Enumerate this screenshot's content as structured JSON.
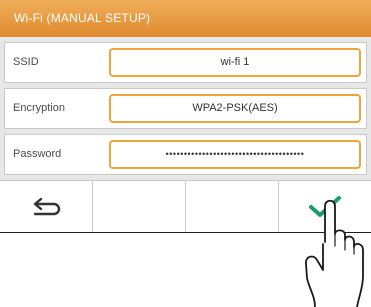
{
  "title": "Wi-Fi (MANUAL SETUP)",
  "rows": [
    {
      "label": "SSID",
      "value": "wi-fi 1"
    },
    {
      "label": "Encryption",
      "value": "WPA2-PSK(AES)"
    },
    {
      "label": "Password",
      "value": "••••••••••••••••••••••••••••••••••••••"
    }
  ],
  "buttons": [
    {
      "icon": "back-arrow-icon"
    },
    {
      "icon": ""
    },
    {
      "icon": ""
    },
    {
      "icon": "checkmark-icon"
    }
  ],
  "colors": {
    "title_bar": "#e8963a",
    "field_border": "#f0a53c",
    "confirm_check": "#1f9a6a"
  }
}
